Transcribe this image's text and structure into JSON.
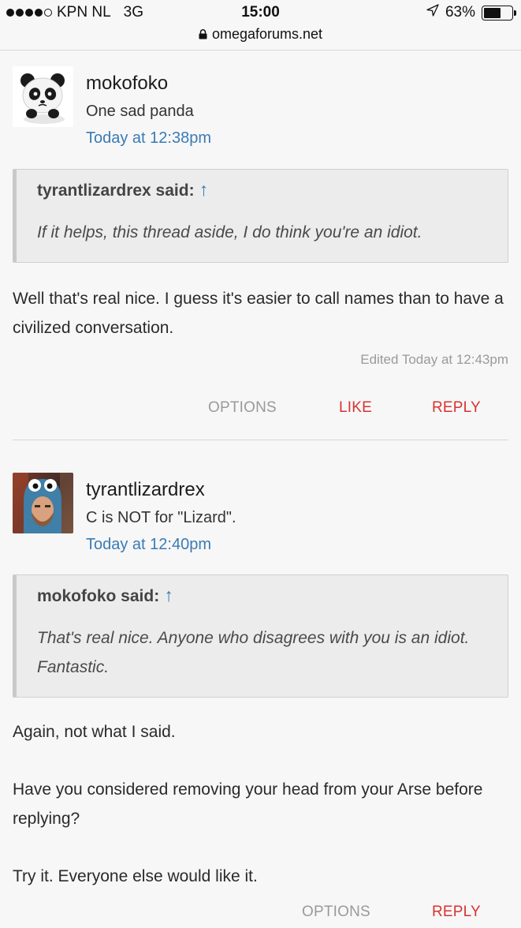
{
  "status_bar": {
    "carrier": "KPN NL",
    "network": "3G",
    "time": "15:00",
    "url": "omegaforums.net",
    "battery": "63%",
    "battery_level": 0.63
  },
  "posts": [
    {
      "username": "mokofoko",
      "user_title": "One sad panda",
      "time": "Today at 12:38pm",
      "avatar_icon": "panda-avatar",
      "quote": {
        "author": "tyrantlizardrex said:",
        "arrow": "↑",
        "text": "If it helps, this thread aside, I do think you're an idiot."
      },
      "message": "Well that's real nice. I guess it's easier to call names than to have a civilized conversation.",
      "edited": "Edited Today at 12:43pm",
      "actions": {
        "options": "OPTIONS",
        "like": "LIKE",
        "reply": "REPLY"
      }
    },
    {
      "username": "tyrantlizardrex",
      "user_title": "C is NOT for \"Lizard\".",
      "time": "Today at 12:40pm",
      "avatar_icon": "user-photo-avatar",
      "quote": {
        "author": "mokofoko said:",
        "arrow": "↑",
        "text": "That's real nice. Anyone who disagrees with you is an idiot. Fantastic."
      },
      "message_paragraphs": [
        "Again, not what I said.",
        "Have you considered removing your head from your Arse before replying?",
        "Try it. Everyone else would like it."
      ],
      "actions": {
        "options": "OPTIONS",
        "reply": "REPLY"
      }
    }
  ],
  "colors": {
    "link_blue": "#3a7bb4",
    "action_red": "#d63431",
    "muted_gray": "#9a9a9a",
    "quote_bg": "#ececec"
  }
}
